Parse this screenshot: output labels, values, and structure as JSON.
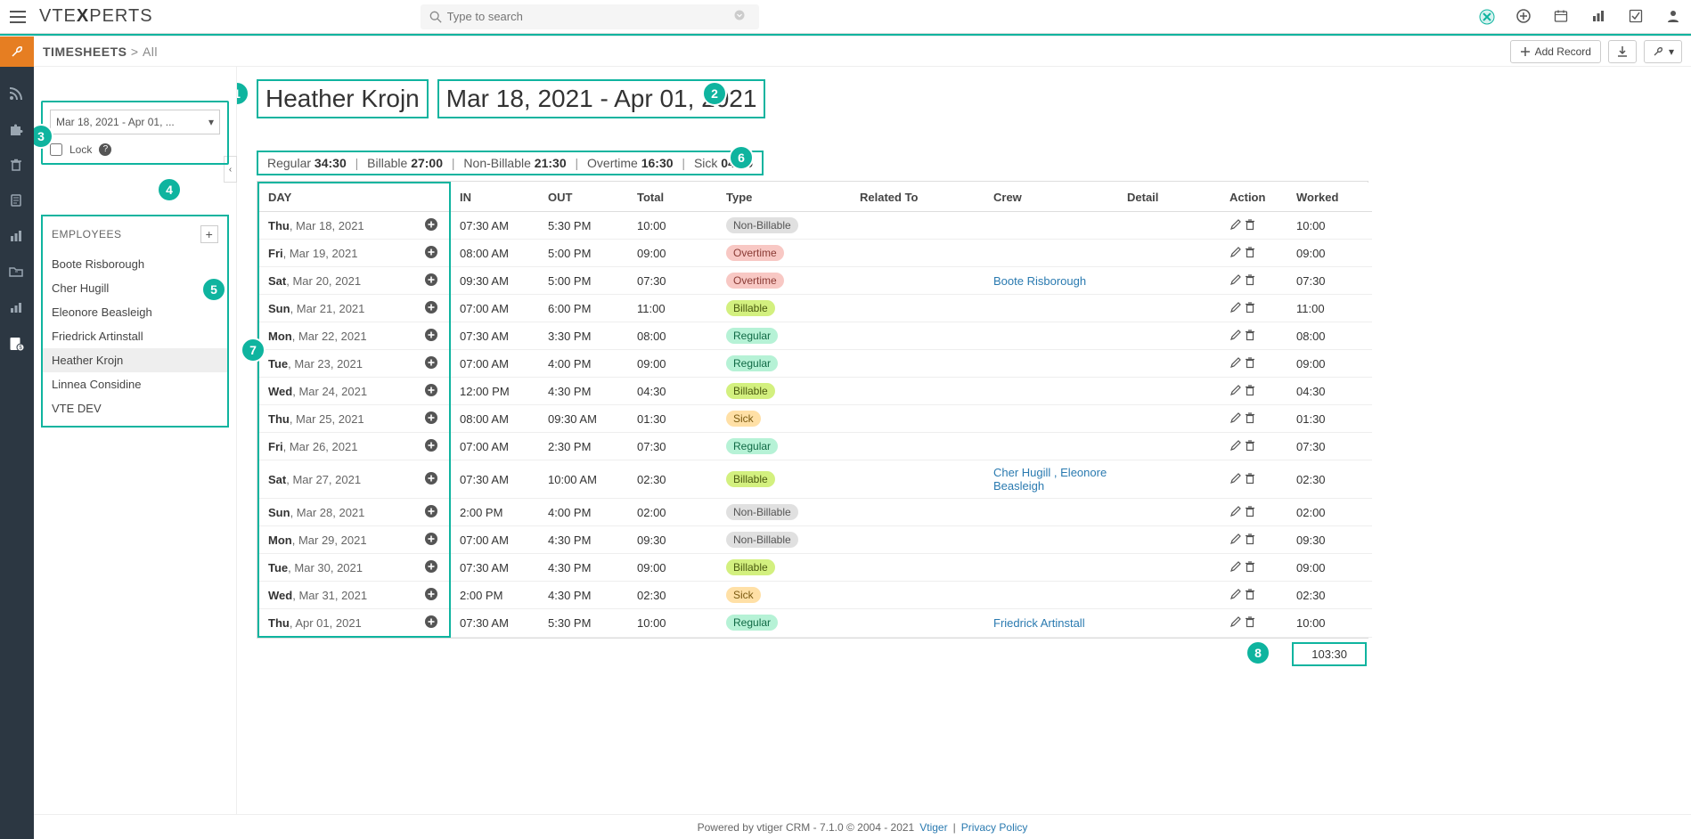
{
  "logo_a": "VTE",
  "logo_b": "X",
  "logo_c": "PERTS",
  "search": {
    "placeholder": "Type to search"
  },
  "breadcrumb": {
    "root": "TIMESHEETS",
    "sep": ">",
    "sub": "All"
  },
  "add_record": "Add Record",
  "employee_name": "Heather Krojn",
  "date_range": "Mar 18, 2021 - Apr 01, 2021",
  "pay_period_select": "Mar 18, 2021 - Apr 01, ...",
  "lock_label": "Lock",
  "employees_label": "EMPLOYEES",
  "employees": [
    "Boote Risborough",
    "Cher Hugill",
    "Eleonore Beasleigh",
    "Friedrick Artinstall",
    "Heather Krojn",
    "Linnea Considine",
    "VTE DEV"
  ],
  "selected_employee_index": 4,
  "stats": {
    "regular_lbl": "Regular",
    "regular_val": "34:30",
    "billable_lbl": "Billable",
    "billable_val": "27:00",
    "nonbillable_lbl": "Non-Billable",
    "nonbillable_val": "21:30",
    "overtime_lbl": "Overtime",
    "overtime_val": "16:30",
    "sick_lbl": "Sick",
    "sick_val": "04:00"
  },
  "columns": [
    "DAY",
    "IN",
    "OUT",
    "Total",
    "Type",
    "Related To",
    "Crew",
    "Detail",
    "Action",
    "Worked"
  ],
  "rows": [
    {
      "wd": "Thu",
      "date": "Mar 18, 2021",
      "in": "07:30 AM",
      "out": "5:30 PM",
      "total": "10:00",
      "type": "Non-Billable",
      "tclass": "nb",
      "crew": "",
      "worked": "10:00"
    },
    {
      "wd": "Fri",
      "date": "Mar 19, 2021",
      "in": "08:00 AM",
      "out": "5:00 PM",
      "total": "09:00",
      "type": "Overtime",
      "tclass": "ot",
      "crew": "",
      "worked": "09:00"
    },
    {
      "wd": "Sat",
      "date": "Mar 20, 2021",
      "in": "09:30 AM",
      "out": "5:00 PM",
      "total": "07:30",
      "type": "Overtime",
      "tclass": "ot",
      "crew": "Boote Risborough",
      "worked": "07:30"
    },
    {
      "wd": "Sun",
      "date": "Mar 21, 2021",
      "in": "07:00 AM",
      "out": "6:00 PM",
      "total": "11:00",
      "type": "Billable",
      "tclass": "bl",
      "crew": "",
      "worked": "11:00"
    },
    {
      "wd": "Mon",
      "date": "Mar 22, 2021",
      "in": "07:30 AM",
      "out": "3:30 PM",
      "total": "08:00",
      "type": "Regular",
      "tclass": "rg",
      "crew": "",
      "worked": "08:00"
    },
    {
      "wd": "Tue",
      "date": "Mar 23, 2021",
      "in": "07:00 AM",
      "out": "4:00 PM",
      "total": "09:00",
      "type": "Regular",
      "tclass": "rg",
      "crew": "",
      "worked": "09:00"
    },
    {
      "wd": "Wed",
      "date": "Mar 24, 2021",
      "in": "12:00 PM",
      "out": "4:30 PM",
      "total": "04:30",
      "type": "Billable",
      "tclass": "bl",
      "crew": "",
      "worked": "04:30"
    },
    {
      "wd": "Thu",
      "date": "Mar 25, 2021",
      "in": "08:00 AM",
      "out": "09:30 AM",
      "total": "01:30",
      "type": "Sick",
      "tclass": "sk",
      "crew": "",
      "worked": "01:30"
    },
    {
      "wd": "Fri",
      "date": "Mar 26, 2021",
      "in": "07:00 AM",
      "out": "2:30 PM",
      "total": "07:30",
      "type": "Regular",
      "tclass": "rg",
      "crew": "",
      "worked": "07:30"
    },
    {
      "wd": "Sat",
      "date": "Mar 27, 2021",
      "in": "07:30 AM",
      "out": "10:00 AM",
      "total": "02:30",
      "type": "Billable",
      "tclass": "bl",
      "crew": "Cher Hugill , Eleonore Beasleigh",
      "worked": "02:30"
    },
    {
      "wd": "Sun",
      "date": "Mar 28, 2021",
      "in": "2:00 PM",
      "out": "4:00 PM",
      "total": "02:00",
      "type": "Non-Billable",
      "tclass": "nb",
      "crew": "",
      "worked": "02:00"
    },
    {
      "wd": "Mon",
      "date": "Mar 29, 2021",
      "in": "07:00 AM",
      "out": "4:30 PM",
      "total": "09:30",
      "type": "Non-Billable",
      "tclass": "nb",
      "crew": "",
      "worked": "09:30"
    },
    {
      "wd": "Tue",
      "date": "Mar 30, 2021",
      "in": "07:30 AM",
      "out": "4:30 PM",
      "total": "09:00",
      "type": "Billable",
      "tclass": "bl",
      "crew": "",
      "worked": "09:00"
    },
    {
      "wd": "Wed",
      "date": "Mar 31, 2021",
      "in": "2:00 PM",
      "out": "4:30 PM",
      "total": "02:30",
      "type": "Sick",
      "tclass": "sk",
      "crew": "",
      "worked": "02:30"
    },
    {
      "wd": "Thu",
      "date": "Apr 01, 2021",
      "in": "07:30 AM",
      "out": "5:30 PM",
      "total": "10:00",
      "type": "Regular",
      "tclass": "rg",
      "crew": "Friedrick Artinstall",
      "worked": "10:00"
    }
  ],
  "total_worked": "103:30",
  "footer": {
    "powered": "Powered by vtiger CRM - 7.1.0  © 2004 - 2021",
    "vtiger": "Vtiger",
    "privacy": "Privacy Policy"
  },
  "callouts": [
    "1",
    "2",
    "3",
    "4",
    "5",
    "6",
    "7",
    "8"
  ]
}
